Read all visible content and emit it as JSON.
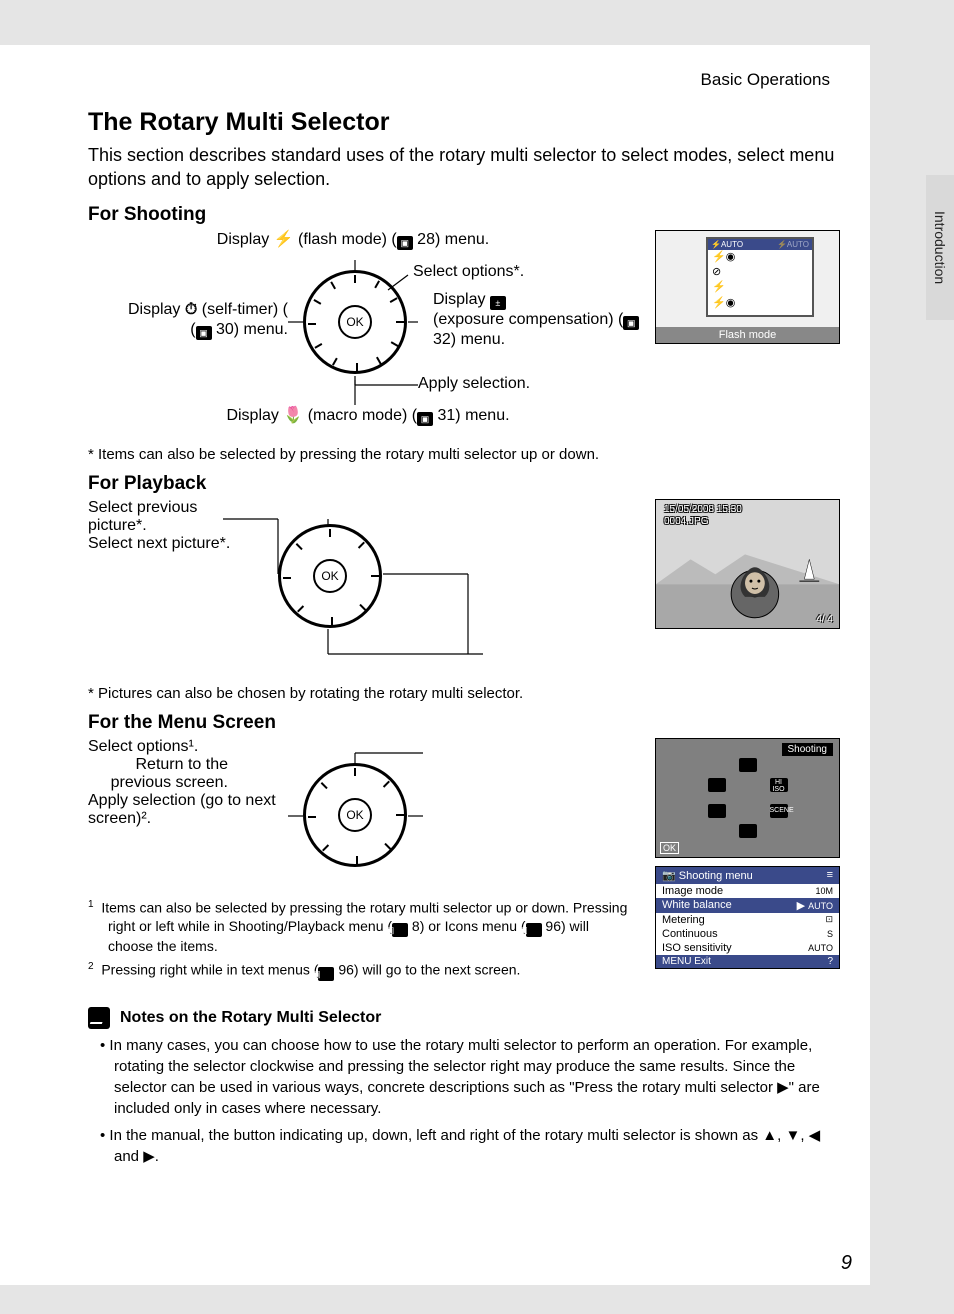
{
  "breadcrumb": "Basic Operations",
  "side_tab": "Introduction",
  "title": "The Rotary Multi Selector",
  "intro": "This section describes standard uses of the rotary multi selector to select modes, select menu options and to apply selection.",
  "shooting": {
    "heading": "For Shooting",
    "top_a": "Display ",
    "top_b": " (flash mode) (",
    "top_c": " 28) menu.",
    "right1": "Select options*.",
    "right2a": "Display ",
    "right2b": " (exposure compensation) (",
    "right2c": " 32) menu.",
    "left_a": "Display ",
    "left_b": " (self-timer) (",
    "left_c": " 30) menu.",
    "center": "Apply selection.",
    "bottom_a": "Display ",
    "bottom_b": " (macro mode) (",
    "bottom_c": " 31) menu.",
    "footnote": "*   Items can also be selected by pressing the rotary multi selector up or down.",
    "thumb_caption": "Flash mode",
    "flash_options": {
      "top_left": "⚡AUTO",
      "top_right": "⚡AUTO",
      "o1": "⚡◉",
      "o2": "⊘",
      "o3": "⚡",
      "o4": "⚡◉"
    }
  },
  "playback": {
    "heading": "For Playback",
    "left": "Select previous picture*.",
    "right": "Select next picture*.",
    "footnote": "*   Pictures can also be chosen by rotating the rotary multi selector.",
    "thumb": {
      "date": "15/05/2008 15:30",
      "file": "0004.JPG",
      "counter": "4/   4"
    }
  },
  "menu": {
    "heading": "For the Menu Screen",
    "top": "Select options¹.",
    "left": "Return to the previous screen.",
    "right": "Apply selection (go to next screen)².",
    "fn1_a": "Items can also be selected by pressing the rotary multi selector up or down. Pressing right or left while in Shooting/Playback menu (",
    "fn1_b": " 8) or Icons menu (",
    "fn1_c": " 96) will choose the items.",
    "fn2_a": "Pressing right while in text menus (",
    "fn2_b": " 96) will go to the next screen.",
    "shooting_label": "Shooting",
    "menu_items": {
      "hdr": "Shooting menu",
      "r1": "Image mode",
      "r2": "White balance",
      "r3": "Metering",
      "r4": "Continuous",
      "r5": "ISO sensitivity",
      "ind1": "10M",
      "ind2": "AUTO",
      "ind3": "⊡",
      "ind4": "S",
      "ind5": "AUTO",
      "ftr_l": "MENU Exit",
      "ftr_r": "?"
    }
  },
  "notes": {
    "title": "Notes on the Rotary Multi Selector",
    "b1": "In many cases, you can choose how to use the rotary multi selector to perform an operation. For example, rotating the selector clockwise and pressing the selector right may produce the same results. Since the selector can be used in various ways, concrete descriptions such as \"Press the rotary multi selector ▶\" are included only in cases where necessary.",
    "b2": "In the manual, the button indicating up, down, left and right of the rotary multi selector is shown as ▲, ▼, ◀ and ▶."
  },
  "page_number": "9"
}
